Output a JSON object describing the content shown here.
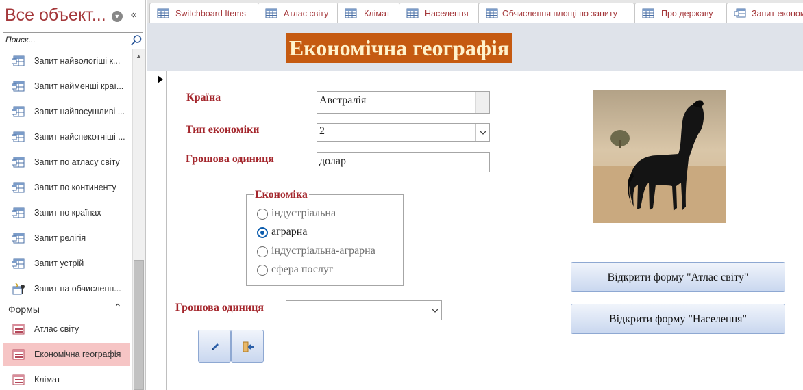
{
  "nav": {
    "title": "Все объект...",
    "search_placeholder": "Поиск...",
    "query_items": [
      {
        "label": "Запит найвологіші к...",
        "icon": "query-icon"
      },
      {
        "label": "Запит найменші краї...",
        "icon": "query-icon"
      },
      {
        "label": "Запит найпосушливі ...",
        "icon": "query-icon"
      },
      {
        "label": "Запит найспекотніші ...",
        "icon": "query-icon"
      },
      {
        "label": "Запит по атласу світу",
        "icon": "query-icon"
      },
      {
        "label": "Запит по континенту",
        "icon": "query-icon"
      },
      {
        "label": "Запит по країнах",
        "icon": "query-icon"
      },
      {
        "label": "Запит релігія",
        "icon": "query-icon"
      },
      {
        "label": "Запит устрій",
        "icon": "query-icon"
      },
      {
        "label": "Запит на обчисленн...",
        "icon": "update-query-icon"
      }
    ],
    "forms_header": "Формы",
    "form_items": [
      {
        "label": "Атлас світу",
        "icon": "form-icon",
        "selected": false
      },
      {
        "label": "Економічна географія",
        "icon": "form-icon",
        "selected": true
      },
      {
        "label": "Клімат",
        "icon": "form-icon",
        "selected": false
      }
    ]
  },
  "tabs": [
    {
      "label": "Switchboard Items"
    },
    {
      "label": "Атлас світу"
    },
    {
      "label": "Клімат"
    },
    {
      "label": "Населення"
    },
    {
      "label": "Обчислення площі по запиту"
    },
    {
      "label": "Про державу"
    },
    {
      "label": "Запит економ"
    }
  ],
  "form": {
    "title": "Економічна географія",
    "country_label": "Країна",
    "country_value": "Австралія",
    "economy_type_label": "Тип економіки",
    "economy_type_value": "2",
    "currency_label": "Грошова одиниця",
    "currency_value": "долар",
    "economy_group": {
      "legend": "Економіка",
      "options": [
        "індустріальна",
        "аграрна",
        "індустріальна-аграрна",
        "сфера послуг"
      ],
      "selected_index": 1
    },
    "currency_combo_label": "Грошова одиниця",
    "currency_combo_value": "",
    "open_atlas_button": "Відкрити форму \"Атлас світу\"",
    "open_population_button": "Відкрити форму \"Населення\""
  },
  "colors": {
    "title_bg": "#c55a11",
    "title_text": "#fff2cc",
    "label_text": "#a4262c",
    "tab_text": "#a4373a",
    "header_bg": "#dfe3ea",
    "selected_nav_bg": "#f6c5c5"
  }
}
